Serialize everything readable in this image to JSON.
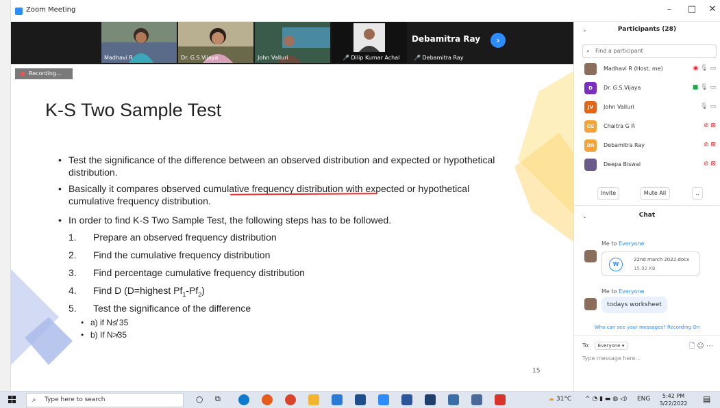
{
  "window": {
    "title": "Zoom Meeting",
    "controls": [
      "–",
      "□",
      "✕"
    ]
  },
  "video_strip": {
    "tiles": [
      {
        "name": "Madhavi R"
      },
      {
        "name": "Dr. G.S.Vijaya"
      },
      {
        "name": "John Valluri"
      },
      {
        "name": "Dilip Kumar Achal",
        "muted": true
      },
      {
        "name": "Debamitra Ray",
        "display_name": "Debamitra Ray",
        "muted": true
      }
    ],
    "next_icon": "chevron-right-icon"
  },
  "recording": {
    "label": "Recording..."
  },
  "slide": {
    "title": "K-S Two Sample Test",
    "bullets": [
      "Test the significance of the difference between an observed distribution and expected or hypothetical distribution.",
      "Basically it compares observed cumulative frequency distribution with expected or hypothetical cumulative frequency distribution.",
      "In order to find K-S Two Sample Test, the following steps has to be followed."
    ],
    "steps": [
      {
        "num": "1.",
        "text": "Prepare an observed frequency distribution"
      },
      {
        "num": "2.",
        "text": "Find the cumulative frequency distribution"
      },
      {
        "num": "3.",
        "text": "Find percentage cumulative frequency distribution"
      },
      {
        "num": "4.",
        "text_pre": "Find D (D=highest Pf",
        "sub1": "1",
        "text_mid": "-Pf",
        "sub2": "2",
        "text_post": ")"
      },
      {
        "num": "5.",
        "text": "Test the significance of the difference"
      }
    ],
    "sub_items": [
      "a) if N≰ 35",
      "b) If N≯35"
    ],
    "page_number": "15",
    "accent_colors": {
      "yellow": "#fde9a8",
      "blue": "#c7d2f0"
    }
  },
  "participants": {
    "header": "Participants (28)",
    "search_placeholder": "Find a participant",
    "list": [
      {
        "name": "Madhavi R (Host, me)",
        "avatar": "photo",
        "color": "#8a6d5b",
        "status": "recording"
      },
      {
        "name": "Dr. G.S.Vijaya",
        "avatar": "D",
        "color": "#7b2fbe",
        "status": "video-on"
      },
      {
        "name": "John Valluri",
        "avatar": "JV",
        "color": "#e0661a",
        "status": "mic-off"
      },
      {
        "name": "Chaitra G R",
        "avatar": "CG",
        "color": "#f4a23a",
        "status": "muted"
      },
      {
        "name": "Debamitra Ray",
        "avatar": "DR",
        "color": "#f4a23a",
        "status": "muted"
      },
      {
        "name": "Deepa Biswal",
        "avatar": "photo",
        "color": "#6a5a8a",
        "status": "muted"
      }
    ],
    "buttons": {
      "invite": "Invite",
      "mute_all": "Mute All",
      "more": ".."
    }
  },
  "chat": {
    "header": "Chat",
    "messages": [
      {
        "from": "Me to ",
        "to": "Everyone",
        "file_name": "22nd march 2022.docx",
        "file_size": "15.92 KB",
        "file_letter": "W"
      },
      {
        "from": "Me to ",
        "to": "Everyone",
        "text": "todays worksheet"
      }
    ],
    "visibility_note": "Who can see your messages? Recording On",
    "to_label": "To:",
    "to_value": "Everyone ▾",
    "input_placeholder": "Type message here..."
  },
  "taskbar": {
    "search_placeholder": "Type here to search",
    "weather": "31°C",
    "language": "ENG",
    "time": "5:42 PM",
    "date": "3/22/2022"
  }
}
